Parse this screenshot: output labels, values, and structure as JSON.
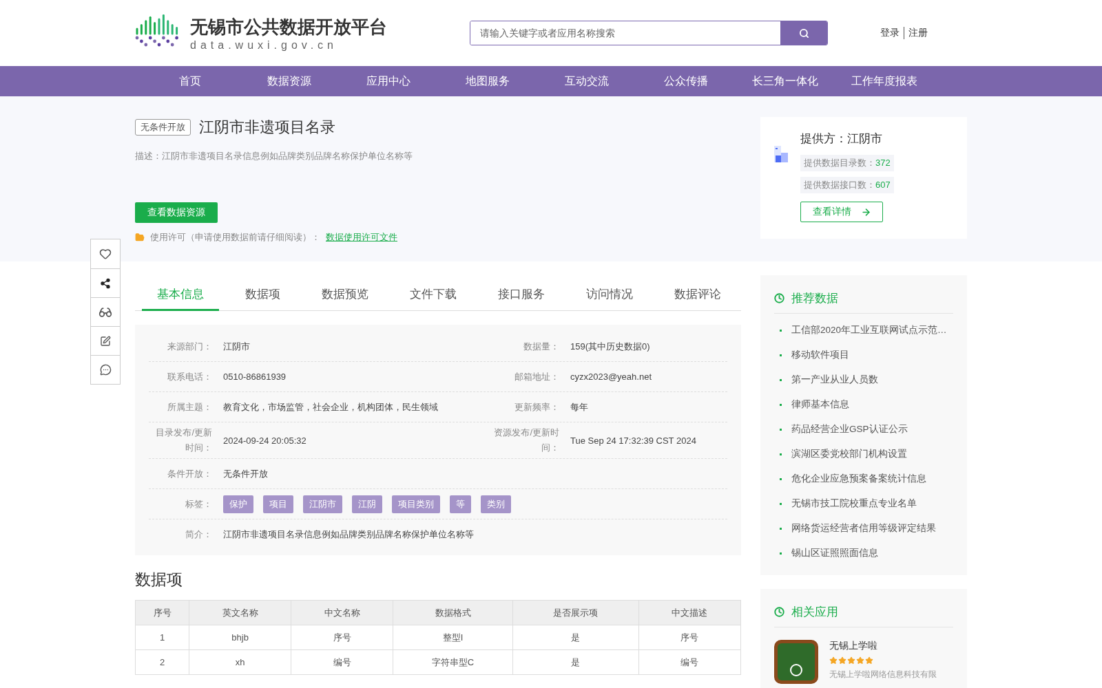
{
  "header": {
    "logo": {
      "title": "无锡市公共数据开放平台",
      "subtitle": "data.wuxi.gov.cn"
    },
    "search": {
      "placeholder": "请输入关键字或者应用名称搜索"
    },
    "auth": [
      "登录",
      "注册"
    ]
  },
  "nav": [
    "首页",
    "数据资源",
    "应用中心",
    "地图服务",
    "互动交流",
    "公众传播",
    "长三角一体化",
    "工作年度报表"
  ],
  "dataset": {
    "badge": "无条件开放",
    "title": "江阴市非遗项目名录",
    "description": "描述：江阴市非遗项目名录信息例如品牌类别品牌名称保护单位名称等",
    "view_button": "查看数据资源",
    "license_label": "使用许可（申请使用数据前请仔细阅读）：",
    "license_link": "数据使用许可文件"
  },
  "provider": {
    "title": "提供方：江阴市",
    "stats": [
      {
        "label": "提供数据目录数：",
        "value": "372"
      },
      {
        "label": "提供数据接口数：",
        "value": "607"
      }
    ],
    "detail_button": "查看详情"
  },
  "tabs": [
    {
      "label": "基本信息",
      "selected": true
    },
    {
      "label": "数据项",
      "selected": false
    },
    {
      "label": "数据预览",
      "selected": false
    },
    {
      "label": "文件下载",
      "selected": false
    },
    {
      "label": "接口服务",
      "selected": false
    },
    {
      "label": "访问情况",
      "selected": false
    },
    {
      "label": "数据评论",
      "selected": false
    }
  ],
  "info": [
    {
      "kind": "pair",
      "cells": [
        {
          "label": "来源部门：",
          "value": "江阴市"
        },
        {
          "label": "数据量：",
          "value": "159(其中历史数据0)"
        }
      ]
    },
    {
      "kind": "pair",
      "cells": [
        {
          "label": "联系电话：",
          "value": "0510-86861939"
        },
        {
          "label": "邮箱地址：",
          "value": "cyzx2023@yeah.net"
        }
      ]
    },
    {
      "kind": "pair",
      "cells": [
        {
          "label": "所属主题：",
          "value": "教育文化，市场监管，社会企业，机构团体，民生领域"
        },
        {
          "label": "更新频率：",
          "value": "每年"
        }
      ]
    },
    {
      "kind": "pair",
      "cells": [
        {
          "label": "目录发布/更新时间：",
          "value": "2024-09-24 20:05:32"
        },
        {
          "label": "资源发布/更新时间：",
          "value": "Tue Sep 24 17:32:39 CST 2024"
        }
      ]
    },
    {
      "kind": "single",
      "label": "条件开放：",
      "value": "无条件开放"
    },
    {
      "kind": "tags",
      "label": "标签：",
      "tags": [
        "保护",
        "项目",
        "江阴市",
        "江阴",
        "项目类别",
        "等",
        "类别"
      ]
    },
    {
      "kind": "single",
      "label": "简介：",
      "value": "江阴市非遗项目名录信息例如品牌类别品牌名称保护单位名称等"
    }
  ],
  "data_items": {
    "title": "数据项",
    "columns": [
      "序号",
      "英文名称",
      "中文名称",
      "数据格式",
      "是否展示项",
      "中文描述"
    ],
    "rows": [
      [
        "1",
        "bhjb",
        "序号",
        "整型I",
        "是",
        "序号"
      ],
      [
        "2",
        "xh",
        "编号",
        "字符串型C",
        "是",
        "编号"
      ]
    ]
  },
  "recommended": {
    "title": "推荐数据",
    "items": [
      "工信部2020年工业互联网试点示范…",
      "移动软件项目",
      "第一产业从业人员数",
      "律师基本信息",
      "药品经营企业GSP认证公示",
      "滨湖区委党校部门机构设置",
      "危化企业应急预案备案统计信息",
      "无锡市技工院校重点专业名单",
      "网络货运经营者信用等级评定结果",
      "锡山区证照照面信息"
    ]
  },
  "related_apps": {
    "title": "相关应用",
    "apps": [
      {
        "name": "无锡上学啦",
        "stars": 5,
        "description": "无锡上学啦网络信息科技有限"
      }
    ]
  }
}
